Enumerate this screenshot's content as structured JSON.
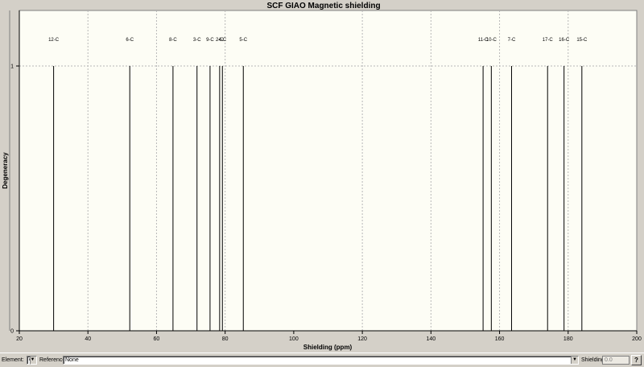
{
  "chart_data": {
    "type": "bar",
    "title": "SCF GIAO Magnetic shielding",
    "xlabel": "Shielding (ppm)",
    "ylabel": "Degeneracy",
    "xlim": [
      20,
      200
    ],
    "ylim": [
      0,
      1.0
    ],
    "xticks": [
      20,
      40,
      60,
      80,
      100,
      120,
      140,
      160,
      180,
      200
    ],
    "yticks": [
      0,
      1
    ],
    "x_gridlines": [
      40,
      60,
      80,
      120,
      140,
      160,
      180
    ],
    "grid": true,
    "peaks": [
      {
        "label": "12-C",
        "x": 30.0,
        "degeneracy": 1
      },
      {
        "label": "6-C",
        "x": 52.2,
        "degeneracy": 1
      },
      {
        "label": "8-C",
        "x": 64.8,
        "degeneracy": 1
      },
      {
        "label": "3-C",
        "x": 71.8,
        "degeneracy": 1
      },
      {
        "label": "9-C",
        "x": 75.6,
        "degeneracy": 1
      },
      {
        "label": "2-C",
        "x": 78.4,
        "degeneracy": 1
      },
      {
        "label": "4-C",
        "x": 79.2,
        "degeneracy": 1
      },
      {
        "label": "5-C",
        "x": 85.3,
        "degeneracy": 1
      },
      {
        "label": "11-C",
        "x": 155.2,
        "degeneracy": 1
      },
      {
        "label": "10-C",
        "x": 157.6,
        "degeneracy": 1
      },
      {
        "label": "7-C",
        "x": 163.5,
        "degeneracy": 1
      },
      {
        "label": "17-C",
        "x": 174.0,
        "degeneracy": 1
      },
      {
        "label": "16-C",
        "x": 178.8,
        "degeneracy": 1
      },
      {
        "label": "15-C",
        "x": 184.0,
        "degeneracy": 1
      }
    ]
  },
  "statusbar": {
    "element_label": "Element:",
    "element_value": "C",
    "reference_label": "Reference:",
    "reference_value": "None",
    "shielding_label": "Shielding:",
    "shielding_value": "0.0",
    "help_label": "?"
  },
  "colors": {
    "plot_bg": "#fdfdf5",
    "frame": "#808080",
    "peak": "#000000",
    "grid": "#b8b8b8",
    "window_bg": "#d4d0c8"
  }
}
